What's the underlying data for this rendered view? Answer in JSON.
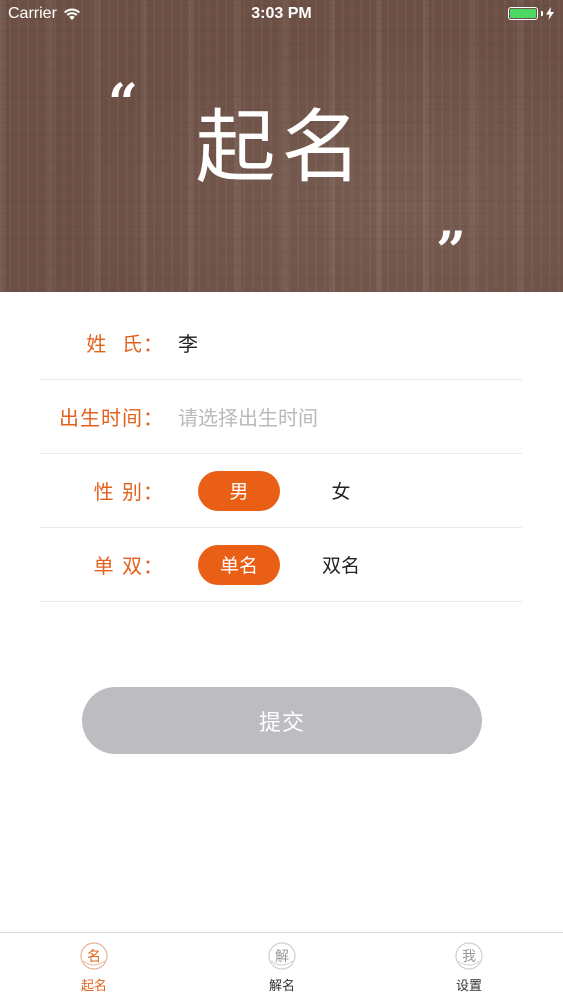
{
  "status_bar": {
    "carrier": "Carrier",
    "time": "3:03 PM",
    "battery_color": "#4cd964"
  },
  "hero": {
    "open_quote": "“",
    "title": "起名",
    "close_quote": "”",
    "background_color": "#6d5045"
  },
  "form": {
    "surname": {
      "label": "姓  氏：",
      "value": "李"
    },
    "birth_time": {
      "label": "出生时间：",
      "placeholder": "请选择出生时间"
    },
    "gender": {
      "label": "性 别：",
      "options": [
        "男",
        "女"
      ],
      "selected": "男"
    },
    "name_length": {
      "label": "单 双：",
      "options": [
        "单名",
        "双名"
      ],
      "selected": "单名"
    }
  },
  "submit": {
    "label": "提交",
    "color": "#bdbdc1"
  },
  "accent_color": "#e3611c",
  "tabbar": {
    "tabs": [
      {
        "label": "起名",
        "icon": "name-seal-icon",
        "icon_char": "名",
        "active": true
      },
      {
        "label": "解名",
        "icon": "interpret-seal-icon",
        "icon_char": "解",
        "active": false
      },
      {
        "label": "设置",
        "icon": "settings-seal-icon",
        "icon_char": "我",
        "active": false
      }
    ]
  }
}
